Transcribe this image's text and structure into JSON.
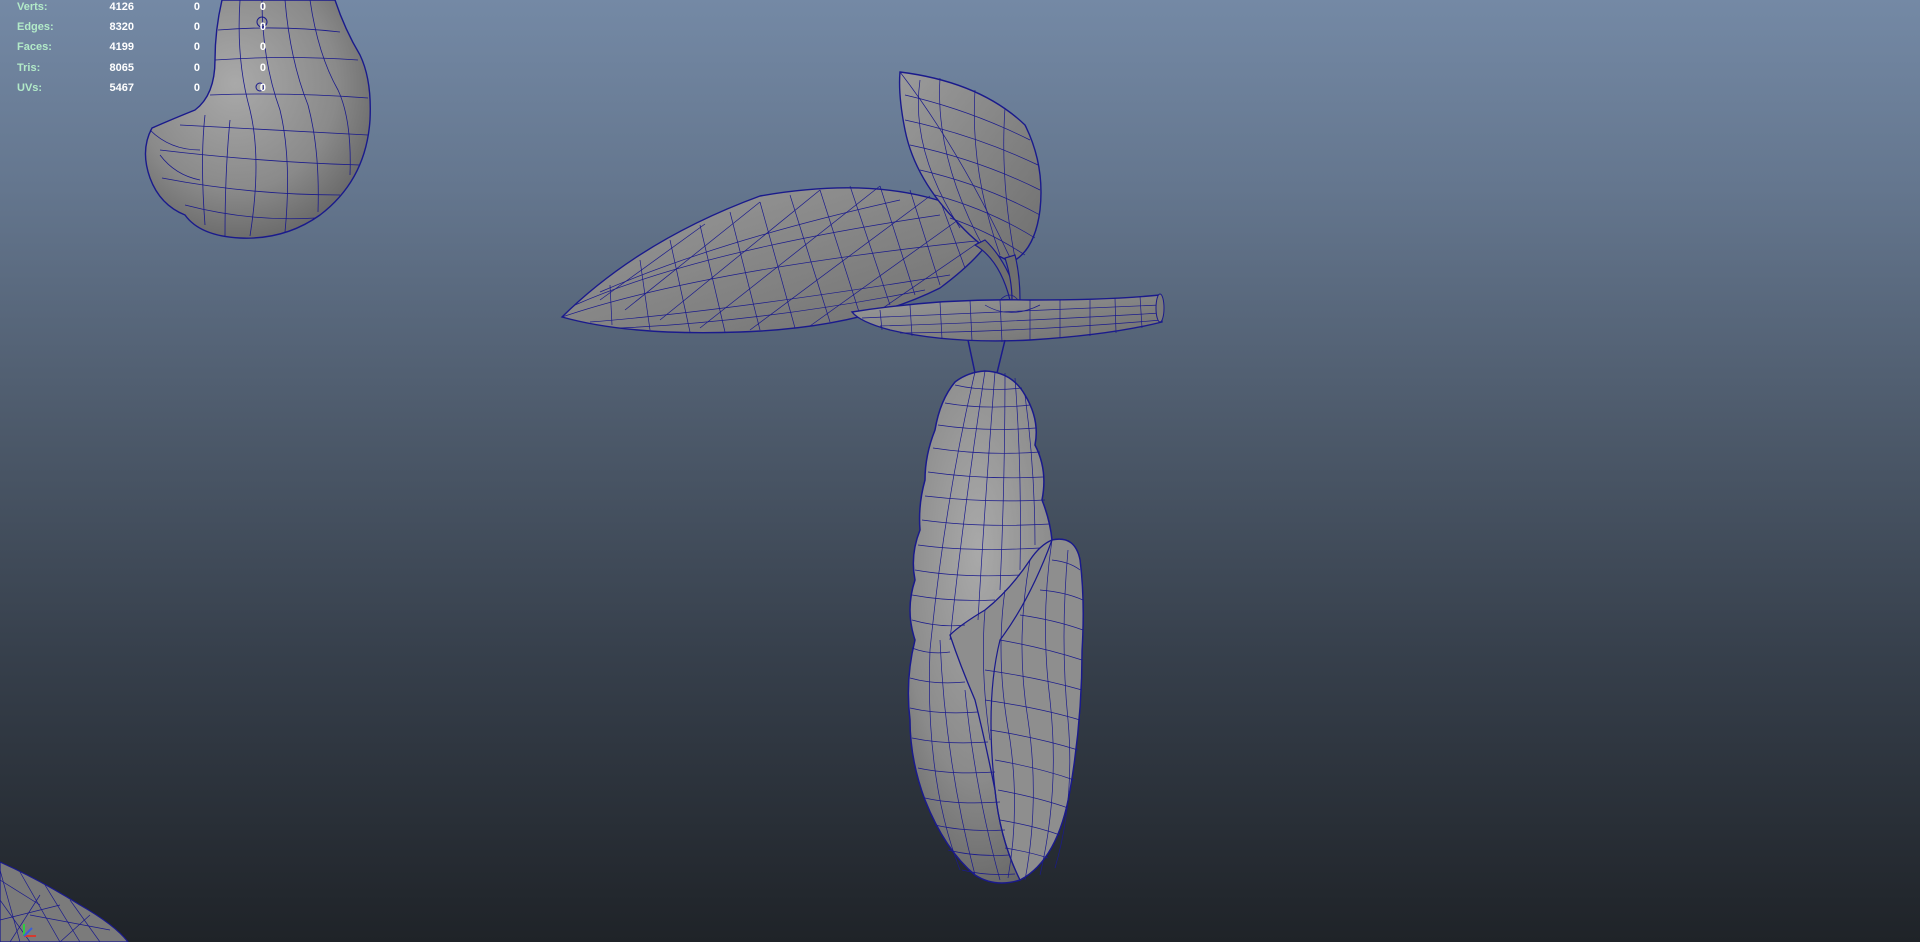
{
  "hud": {
    "rows": [
      {
        "label": "Verts:",
        "count": "4126",
        "selected": "0",
        "uv_selected": "0"
      },
      {
        "label": "Edges:",
        "count": "8320",
        "selected": "0",
        "uv_selected": "0"
      },
      {
        "label": "Faces:",
        "count": "4199",
        "selected": "0",
        "uv_selected": "0"
      },
      {
        "label": "Tris:",
        "count": "8065",
        "selected": "0",
        "uv_selected": "0"
      },
      {
        "label": "UVs:",
        "count": "5467",
        "selected": "0",
        "uv_selected": "0"
      }
    ]
  },
  "viewport": {
    "background_top": "#7489a5",
    "background_bottom": "#1f2328",
    "wire_color": "#1a1a8c",
    "mesh_color": "#8c8c8c",
    "label_color": "#b2eac8"
  },
  "scene_objects": [
    "leaf-large",
    "leaf-small",
    "branch",
    "chrysalis",
    "partial-mesh-top-left",
    "partial-mesh-bottom-left"
  ],
  "axis_gizmo": {
    "icon": "axis-gizmo-icon"
  }
}
